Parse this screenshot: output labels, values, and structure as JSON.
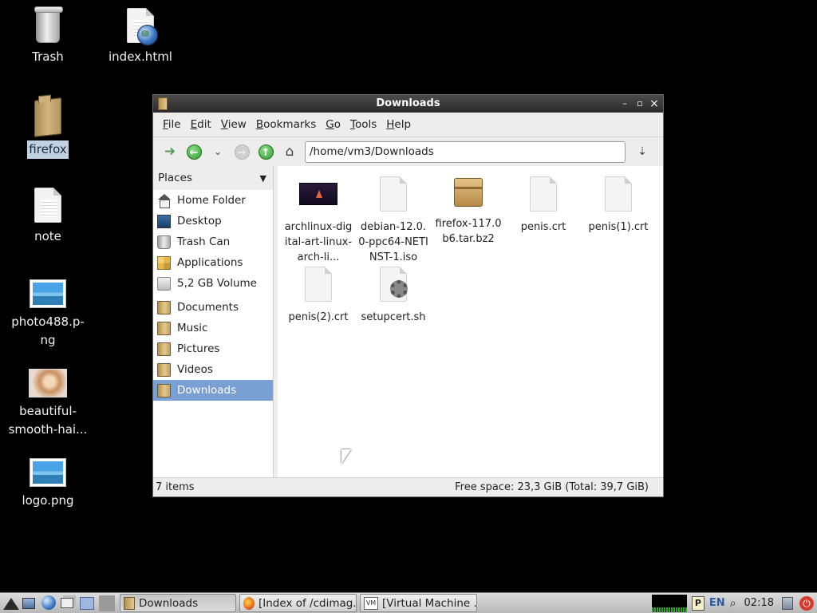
{
  "desktop": {
    "icons": [
      {
        "label": "Trash"
      },
      {
        "label": "index.html"
      },
      {
        "label": "firefox"
      },
      {
        "label": "note"
      },
      {
        "label": "photo488.p-ng"
      },
      {
        "label": "beautiful-smooth-hai..."
      },
      {
        "label": "logo.png"
      }
    ]
  },
  "window": {
    "title": "Downloads",
    "controls": {
      "minimize": "–",
      "maximize": "▫",
      "close": "×"
    },
    "menu": [
      "File",
      "Edit",
      "View",
      "Bookmarks",
      "Go",
      "Tools",
      "Help"
    ],
    "address": "/home/vm3/Downloads",
    "sidebar": {
      "header": "Places",
      "items": [
        {
          "label": "Home Folder"
        },
        {
          "label": "Desktop"
        },
        {
          "label": "Trash Can"
        },
        {
          "label": "Applications"
        },
        {
          "label": "5,2 GB Volume"
        },
        {
          "label": "Documents"
        },
        {
          "label": "Music"
        },
        {
          "label": "Pictures"
        },
        {
          "label": "Videos"
        },
        {
          "label": "Downloads"
        }
      ]
    },
    "files": [
      {
        "name": "archlinux-digital-art-linux-arch-li..."
      },
      {
        "name": "debian-12.0.0-ppc64-NETINST-1.iso"
      },
      {
        "name": "firefox-117.0b6.tar.bz2"
      },
      {
        "name": "penis.crt"
      },
      {
        "name": "penis(1).crt"
      },
      {
        "name": "penis(2).crt"
      },
      {
        "name": "setupcert.sh"
      }
    ],
    "status": {
      "items": "7 items",
      "free": "Free space: 23,3 GiB (Total: 39,7 GiB)"
    }
  },
  "taskbar": {
    "tasks": [
      {
        "label": "Downloads"
      },
      {
        "label": "[Index of /cdimag..."
      },
      {
        "label": "[Virtual Machine ..."
      }
    ],
    "tray": {
      "keyboard": "EN",
      "clock": "02:18"
    }
  },
  "colors": {
    "selection": "#7a9fd2",
    "titlebar": "#2a2a2a",
    "desktop": "#000000"
  }
}
